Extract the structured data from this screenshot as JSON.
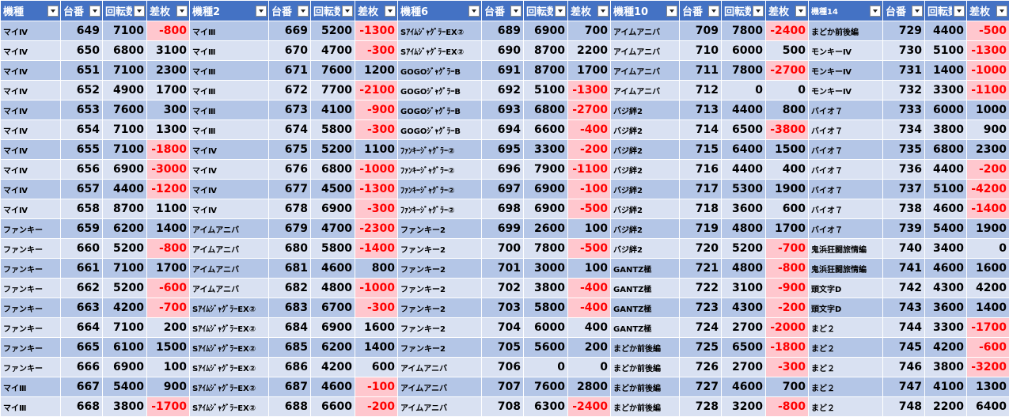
{
  "headers": [
    "機種",
    "台番",
    "回転数",
    "差枚",
    "機種2",
    "台番",
    "回転数",
    "差枚",
    "機種6",
    "台番",
    "回転数",
    "差枚",
    "機種10",
    "台番",
    "回転数",
    "差枚",
    "機種14",
    "台番",
    "回転数",
    "差枚"
  ],
  "rows": [
    [
      "マイⅣ",
      649,
      7100,
      -800,
      "マイⅢ",
      669,
      5200,
      -1300,
      "SｱｲﾑｼﾞｬｸﾞﾗｰEX②",
      689,
      6900,
      700,
      "アイムアニバ",
      709,
      7800,
      -2400,
      "まどか前後編",
      729,
      4400,
      -500
    ],
    [
      "マイⅣ",
      650,
      6800,
      3100,
      "マイⅢ",
      670,
      4700,
      -300,
      "SｱｲﾑｼﾞｬｸﾞﾗｰEX②",
      690,
      8700,
      2200,
      "アイムアニバ",
      710,
      6000,
      500,
      "モンキーⅣ",
      730,
      5100,
      -1300
    ],
    [
      "マイⅣ",
      651,
      7100,
      2300,
      "マイⅢ",
      671,
      7600,
      1200,
      "GOGOｼﾞｬｸﾞﾗｰB",
      691,
      8700,
      1700,
      "アイムアニバ",
      711,
      7800,
      -2700,
      "モンキーⅣ",
      731,
      1400,
      -1000
    ],
    [
      "マイⅣ",
      652,
      4900,
      1700,
      "マイⅢ",
      672,
      7700,
      -2100,
      "GOGOｼﾞｬｸﾞﾗｰB",
      692,
      5100,
      -1300,
      "アイムアニバ",
      712,
      0,
      0,
      "モンキーⅣ",
      732,
      3300,
      -1100
    ],
    [
      "マイⅣ",
      653,
      7600,
      300,
      "マイⅢ",
      673,
      4100,
      -900,
      "GOGOｼﾞｬｸﾞﾗｰB",
      693,
      6800,
      -2700,
      "バジ絆2",
      713,
      4400,
      800,
      "バイオ７",
      733,
      6000,
      1000
    ],
    [
      "マイⅣ",
      654,
      7100,
      1300,
      "マイⅢ",
      674,
      5800,
      -300,
      "GOGOｼﾞｬｸﾞﾗｰB",
      694,
      6600,
      -400,
      "バジ絆2",
      714,
      6500,
      -3800,
      "バイオ７",
      734,
      3800,
      900
    ],
    [
      "マイⅣ",
      655,
      7100,
      -1800,
      "マイⅣ",
      675,
      5200,
      1100,
      "ﾌｧﾝｷｰｼﾞｬｸﾞﾗｰ②",
      695,
      3300,
      -200,
      "バジ絆2",
      715,
      6400,
      1500,
      "バイオ７",
      735,
      6800,
      2300
    ],
    [
      "マイⅣ",
      656,
      6900,
      -3000,
      "マイⅣ",
      676,
      6800,
      -1000,
      "ﾌｧﾝｷｰｼﾞｬｸﾞﾗｰ②",
      696,
      7900,
      -1100,
      "バジ絆2",
      716,
      4400,
      400,
      "バイオ７",
      736,
      4400,
      -200
    ],
    [
      "マイⅣ",
      657,
      4400,
      -1200,
      "マイⅣ",
      677,
      4500,
      -1300,
      "ﾌｧﾝｷｰｼﾞｬｸﾞﾗｰ②",
      697,
      6900,
      -100,
      "バジ絆2",
      717,
      5300,
      1900,
      "バイオ７",
      737,
      5100,
      -4200
    ],
    [
      "マイⅣ",
      658,
      8700,
      1100,
      "マイⅣ",
      678,
      6900,
      -300,
      "ﾌｧﾝｷｰｼﾞｬｸﾞﾗｰ②",
      698,
      6900,
      -500,
      "バジ絆2",
      718,
      3600,
      600,
      "バイオ７",
      738,
      4600,
      -1400
    ],
    [
      "ファンキー",
      659,
      6200,
      1400,
      "アイムアニバ",
      679,
      4700,
      -2300,
      "ファンキー2",
      699,
      2600,
      100,
      "バジ絆2",
      719,
      4800,
      1700,
      "バイオ７",
      739,
      5400,
      1900
    ],
    [
      "ファンキー",
      660,
      5200,
      -800,
      "アイムアニバ",
      680,
      5800,
      -1400,
      "ファンキー2",
      700,
      7800,
      -500,
      "バジ絆2",
      720,
      5200,
      -700,
      "鬼浜狂闘旅情編",
      740,
      3400,
      0
    ],
    [
      "ファンキー",
      661,
      7100,
      1700,
      "アイムアニバ",
      681,
      4600,
      800,
      "ファンキー2",
      701,
      3000,
      100,
      "GANTZ極",
      721,
      4800,
      -800,
      "鬼浜狂闘旅情編",
      741,
      4600,
      1600
    ],
    [
      "ファンキー",
      662,
      5200,
      -600,
      "アイムアニバ",
      682,
      4800,
      -1000,
      "ファンキー2",
      702,
      3800,
      -400,
      "GANTZ極",
      722,
      3100,
      -900,
      "頭文字D",
      742,
      4300,
      4200
    ],
    [
      "ファンキー",
      663,
      4200,
      -700,
      "SｱｲﾑｼﾞｬｸﾞﾗｰEX②",
      683,
      6700,
      -300,
      "ファンキー2",
      703,
      5800,
      -400,
      "GANTZ極",
      723,
      4300,
      -200,
      "頭文字D",
      743,
      3600,
      1400
    ],
    [
      "ファンキー",
      664,
      7100,
      200,
      "SｱｲﾑｼﾞｬｸﾞﾗｰEX②",
      684,
      6900,
      1600,
      "ファンキー2",
      704,
      6000,
      400,
      "GANTZ極",
      724,
      2700,
      -2000,
      "まど２",
      744,
      3300,
      -1700
    ],
    [
      "ファンキー",
      665,
      6100,
      1500,
      "SｱｲﾑｼﾞｬｸﾞﾗｰEX②",
      685,
      6200,
      1400,
      "ファンキー2",
      705,
      5600,
      200,
      "まどか前後編",
      725,
      6500,
      -1800,
      "まど２",
      745,
      4200,
      -600
    ],
    [
      "ファンキー",
      666,
      6900,
      100,
      "SｱｲﾑｼﾞｬｸﾞﾗｰEX②",
      686,
      4200,
      600,
      "アイムアニバ",
      706,
      0,
      0,
      "まどか前後編",
      726,
      2700,
      -300,
      "まど２",
      746,
      3800,
      -3200
    ],
    [
      "マイⅢ",
      667,
      5400,
      900,
      "SｱｲﾑｼﾞｬｸﾞﾗｰEX②",
      687,
      4600,
      -100,
      "アイムアニバ",
      707,
      7600,
      2800,
      "まどか前後編",
      727,
      4600,
      700,
      "まど２",
      747,
      4100,
      1300
    ],
    [
      "マイⅢ",
      668,
      3800,
      -1700,
      "SｱｲﾑｼﾞｬｸﾞﾗｰEX②",
      688,
      6600,
      -200,
      "アイムアニバ",
      708,
      6300,
      -2400,
      "まどか前後編",
      728,
      3200,
      -800,
      "まど２",
      748,
      2200,
      6400
    ]
  ]
}
